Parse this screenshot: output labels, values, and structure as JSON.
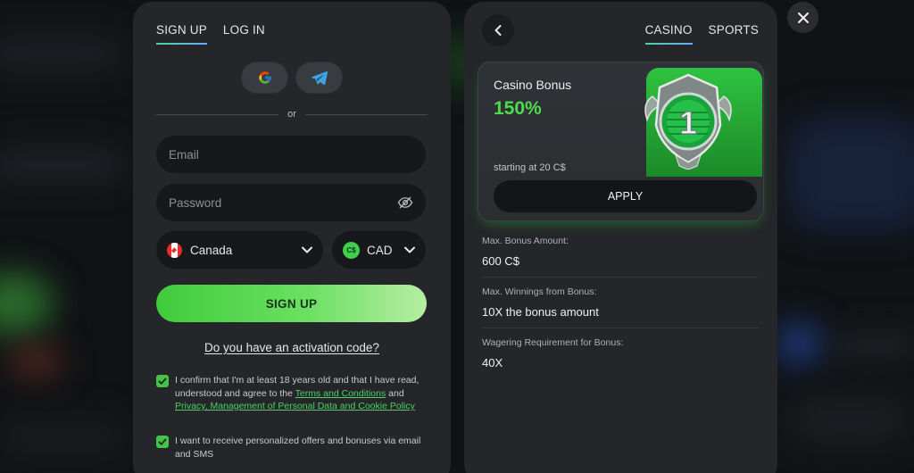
{
  "auth": {
    "tabs": [
      {
        "label": "SIGN UP",
        "active": true
      },
      {
        "label": "LOG IN",
        "active": false
      }
    ],
    "social": [
      "google-icon",
      "telegram-icon"
    ],
    "divider_text": "or",
    "email_placeholder": "Email",
    "password_placeholder": "Password",
    "country": {
      "flag": "canada-flag-icon",
      "value": "Canada"
    },
    "currency": {
      "symbol": "C$",
      "value": "CAD"
    },
    "signup_label": "SIGN UP",
    "activation_link": "Do you have an activation code?",
    "consent": {
      "text_before": "I confirm that I'm at least 18 years old and that I have read, understood and agree to the ",
      "link1": "Terms and Conditions",
      "text_middle": " and ",
      "link2": "Privacy, Management of Personal Data and Cookie Policy",
      "checked": true
    },
    "offers": {
      "text": "I want to receive personalized offers and bonuses via email and SMS",
      "checked": true
    }
  },
  "bonus": {
    "tabs": [
      {
        "label": "CASINO",
        "active": true
      },
      {
        "label": "SPORTS",
        "active": false
      }
    ],
    "card": {
      "title": "Casino Bonus",
      "percent": "150%",
      "starting": "starting at 20 C$",
      "apply_label": "APPLY",
      "medal_number": "1"
    },
    "details": [
      {
        "label": "Max. Bonus Amount:",
        "value": "600 C$"
      },
      {
        "label": "Max. Winnings from Bonus:",
        "value": "10X the bonus amount"
      },
      {
        "label": "Wagering Requirement for Bonus:",
        "value": "40X"
      }
    ]
  },
  "colors": {
    "accent_green": "#4fdb4e",
    "panel": "#242629",
    "field": "#17181b",
    "link": "#4fcf66"
  }
}
